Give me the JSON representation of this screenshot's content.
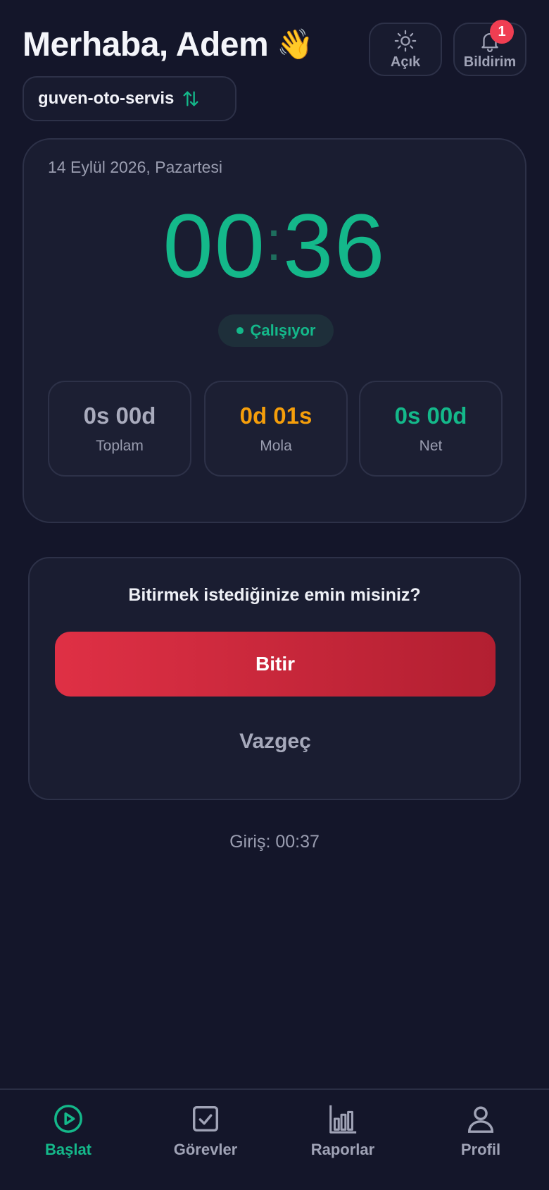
{
  "header": {
    "greeting": "Merhaba, Adem",
    "wave_emoji": "👋",
    "theme_button_label": "Açık",
    "notification_button_label": "Bildirim",
    "notification_count": "1"
  },
  "company": {
    "name": "guven-oto-servis",
    "switch_icon": "swap-vertical-icon"
  },
  "timer_card": {
    "date": "14 Eylül 2026, Pazartesi",
    "minutes": "00",
    "colon": ":",
    "seconds": "36",
    "status": "Çalışıyor",
    "stats": {
      "total": {
        "value": "0s 00d",
        "label": "Toplam"
      },
      "break": {
        "value": "0d 01s",
        "label": "Mola"
      },
      "net": {
        "value": "0s 00d",
        "label": "Net"
      }
    }
  },
  "confirm": {
    "question": "Bitirmek istediğinize emin misiniz?",
    "finish_label": "Bitir",
    "cancel_label": "Vazgeç"
  },
  "login_time": "Giriş: 00:37",
  "nav": {
    "items": [
      {
        "label": "Başlat",
        "icon": "play-circle-icon",
        "active": true
      },
      {
        "label": "Görevler",
        "icon": "checkbox-icon",
        "active": false
      },
      {
        "label": "Raporlar",
        "icon": "bar-chart-icon",
        "active": false
      },
      {
        "label": "Profil",
        "icon": "user-icon",
        "active": false
      }
    ]
  },
  "colors": {
    "background": "#14162a",
    "accent_green": "#14b88a",
    "accent_orange": "#f59e0b",
    "danger_red": "#df3045"
  }
}
